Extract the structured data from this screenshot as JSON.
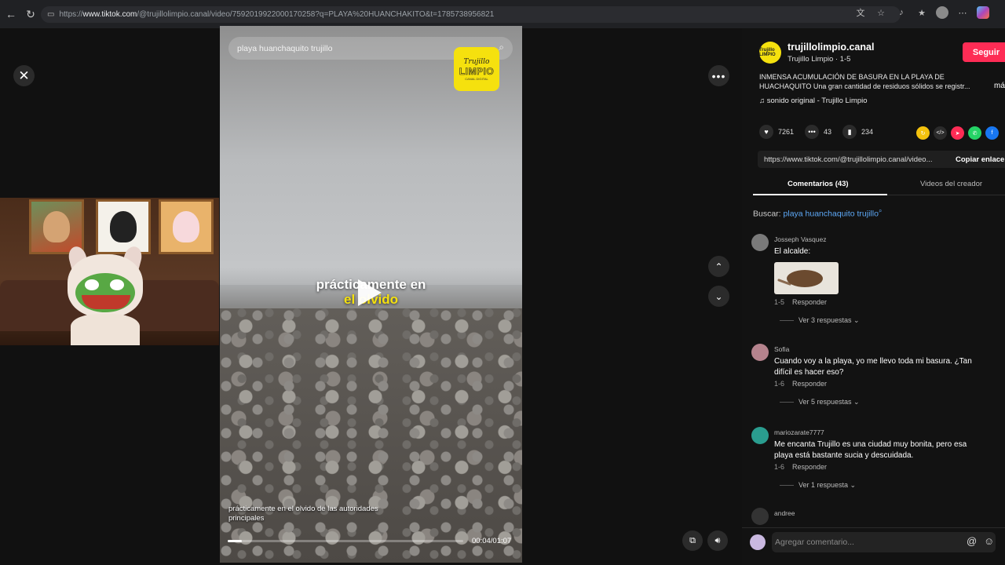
{
  "browser": {
    "url_prefix": "https://",
    "url_host": "www.tiktok.com",
    "url_path": "/@trujillolimpio.canal/video/7592019922000170258?q=PLAYA%20HUANCHAKITO&t=1785738956821"
  },
  "video": {
    "search_placeholder": "playa huanchaquito trujillo",
    "logo_line1": "Trujillo",
    "logo_line2": "LIMPIO",
    "logo_line3": "CANAL DIGITAL",
    "caption_line1": "prácticamente en",
    "caption_line2": "el olvido",
    "subtitle": "prácticamente en el olvido de las autoridades principales",
    "time": "00:04/01:07",
    "progress_fraction": 0.06
  },
  "creator": {
    "name": "trujillolimpio.canal",
    "subline": "Trujillo Limpio · 1-5",
    "follow_label": "Seguir",
    "avatar_text": "Trujillo LIMPIO",
    "description": "INMENSA ACUMULACIÓN DE BASURA EN LA PLAYA DE HUACHAQUITO Una gran cantidad de residuos sólidos se registr...",
    "more_label": "más",
    "sound": "sonido original - Trujillo Limpio"
  },
  "stats": {
    "likes": "7261",
    "comments": "43",
    "saves": "234"
  },
  "link": {
    "url": "https://www.tiktok.com/@trujillolimpio.canal/video...",
    "copy_label": "Copiar enlace"
  },
  "tabs": {
    "comments": "Comentarios (43)",
    "creator_videos": "Videos del creador"
  },
  "search": {
    "prefix": "Buscar: ",
    "term": "playa huanchaquito trujillo"
  },
  "comments": [
    {
      "user": "Josseph Vasquez",
      "text": "El alcalde:",
      "date": "1-5",
      "reply": "Responder",
      "more": "Ver 3 respuestas"
    },
    {
      "user": "Sofia",
      "text": "Cuando voy a la playa, yo me llevo toda mi basura. ¿Tan difícil es hacer eso?",
      "date": "1-6",
      "reply": "Responder",
      "more": "Ver 5 respuestas"
    },
    {
      "user": "mariozarate7777",
      "text": "Me encanta Trujillo es una ciudad muy bonita, pero esa playa está bastante sucia y descuidada.",
      "date": "1-6",
      "reply": "Responder",
      "more": "Ver 1 respuesta"
    },
    {
      "user": "andree",
      "text": "",
      "date": "",
      "reply": "",
      "more": ""
    }
  ],
  "add_comment": {
    "placeholder": "Agregar comentario..."
  },
  "colors": {
    "accent": "#fe2c55",
    "brand_yellow": "#f5e10e",
    "link_blue": "#5da8f6"
  }
}
